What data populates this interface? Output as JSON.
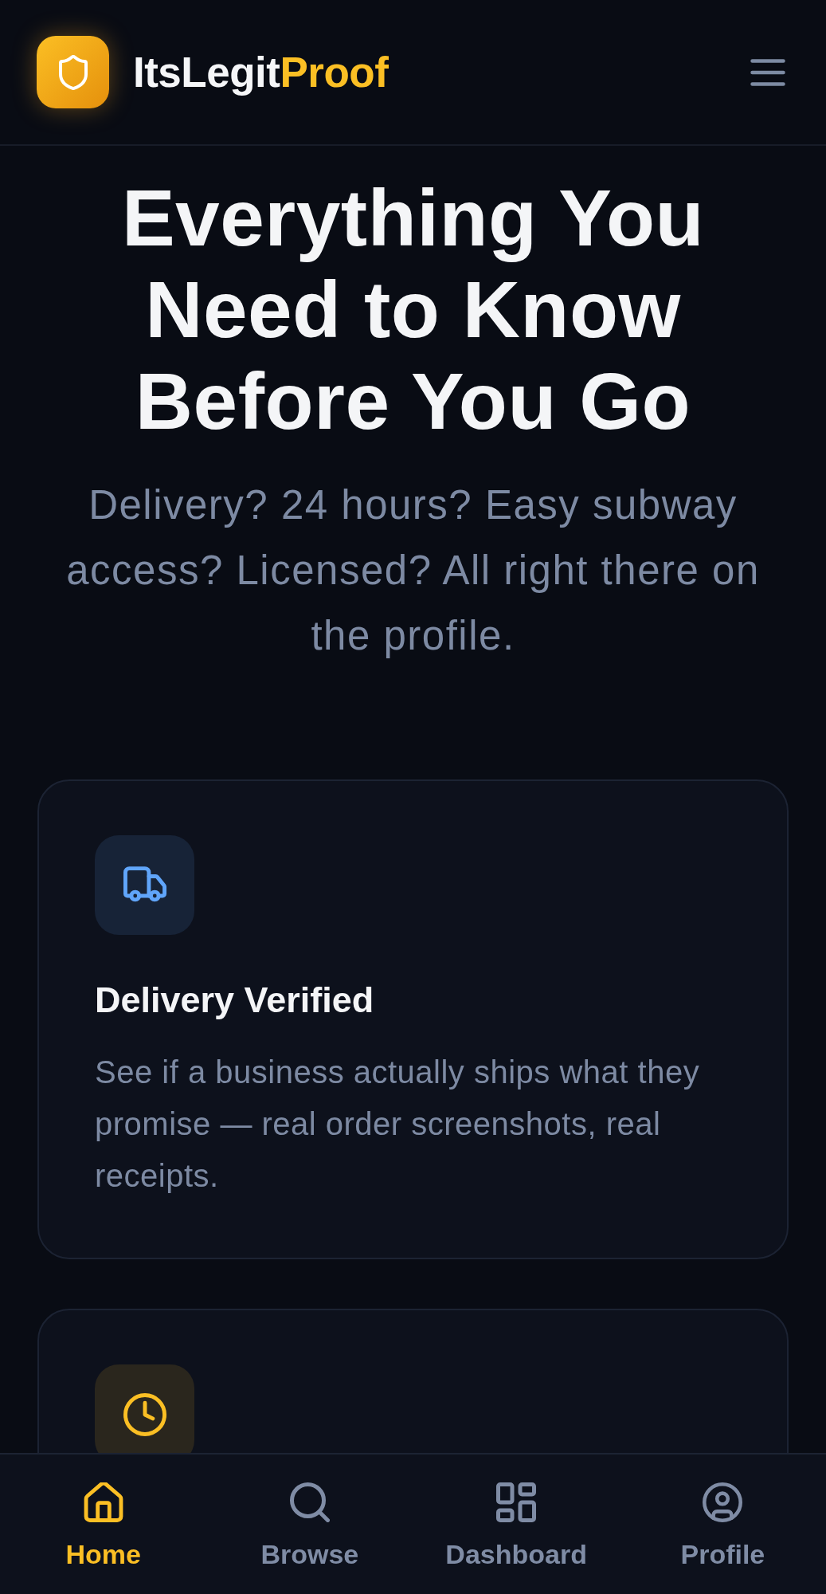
{
  "header": {
    "brand": {
      "name": "ItsLegit",
      "accent": "Proof"
    }
  },
  "hero": {
    "title": "Everything You Need to Know Before You Go",
    "subtitle": "Delivery? 24 hours? Easy subway access? Licensed? All right there on the profile."
  },
  "features": [
    {
      "title": "Delivery Verified",
      "description": "See if a business actually ships what they promise — real order screenshots, real receipts.",
      "color": "#60a5fa"
    },
    {
      "color": "#fbbf24"
    }
  ],
  "nav": [
    {
      "label": "Home",
      "selected": true
    },
    {
      "label": "Browse",
      "selected": false
    },
    {
      "label": "Dashboard",
      "selected": false
    },
    {
      "label": "Profile",
      "selected": false
    }
  ]
}
